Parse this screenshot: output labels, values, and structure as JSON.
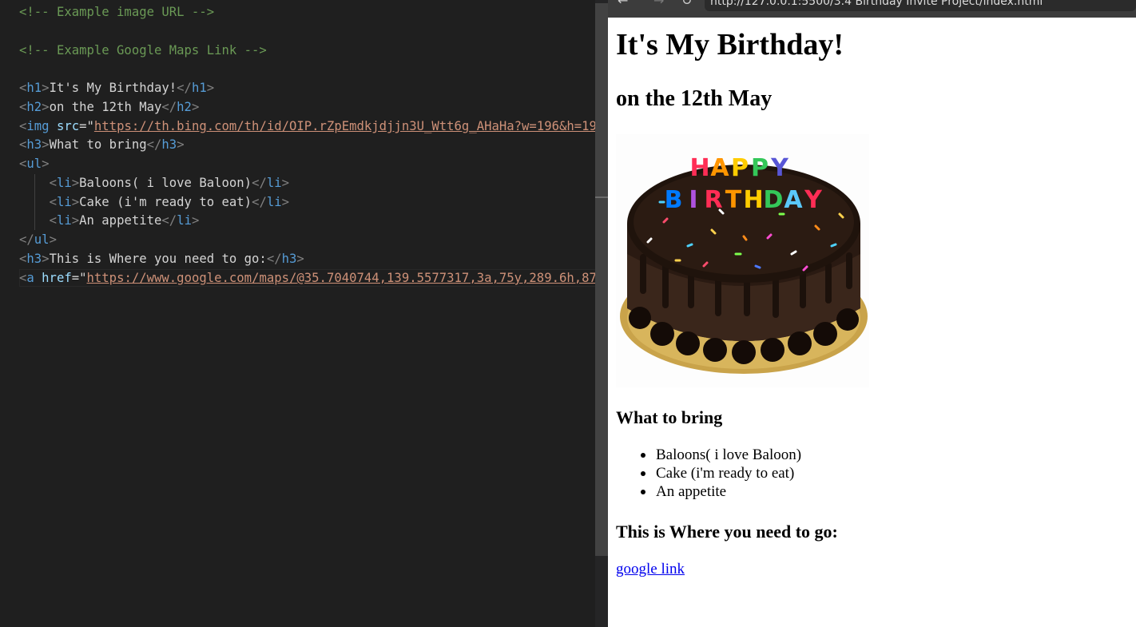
{
  "editor": {
    "lines": {
      "comment_image": "<!-- Example image URL -->",
      "comment_maps": "<!-- Example Google Maps Link -->",
      "h1_text": "It's My Birthday!",
      "h2_text": "on the 12th May",
      "img_attr": "src",
      "img_src": "https://th.bing.com/th/id/OIP.rZpEmdkjdjjn3U_Wtt6g_AHaHa?w=196&h=19",
      "h3_bring": "What to bring",
      "li_1": "Baloons( i love Baloon)",
      "li_2": "Cake (i'm ready to eat)",
      "li_3": "An appetite",
      "h3_where": "This is Where you need to go:",
      "a_attr": "href",
      "a_href": "https://www.google.com/maps/@35.7040744,139.5577317,3a,75y,289.6h,87"
    }
  },
  "browser": {
    "url": "http://127.0.0.1:5500/3.4 Birthday Invite Project/index.html",
    "back_icon": "arrow-left-icon",
    "forward_icon": "arrow-right-icon",
    "reload_icon": "reload-icon"
  },
  "page": {
    "title": "It's My Birthday!",
    "subtitle": "on the 12th May",
    "cake_candles_text": "HAPPY BIRTHDAY",
    "bring_heading": "What to bring",
    "bring_items": [
      "Baloons( i love Baloon)",
      "Cake (i'm ready to eat)",
      "An appetite"
    ],
    "where_heading": "This is Where you need to go:",
    "link_text": "google link"
  },
  "colors": {
    "editor_bg": "#1f1f1f",
    "comment": "#6a9955",
    "tag": "#569cd6",
    "attribute": "#9cdcfe",
    "string": "#ce9178",
    "link": "#0000ee"
  }
}
